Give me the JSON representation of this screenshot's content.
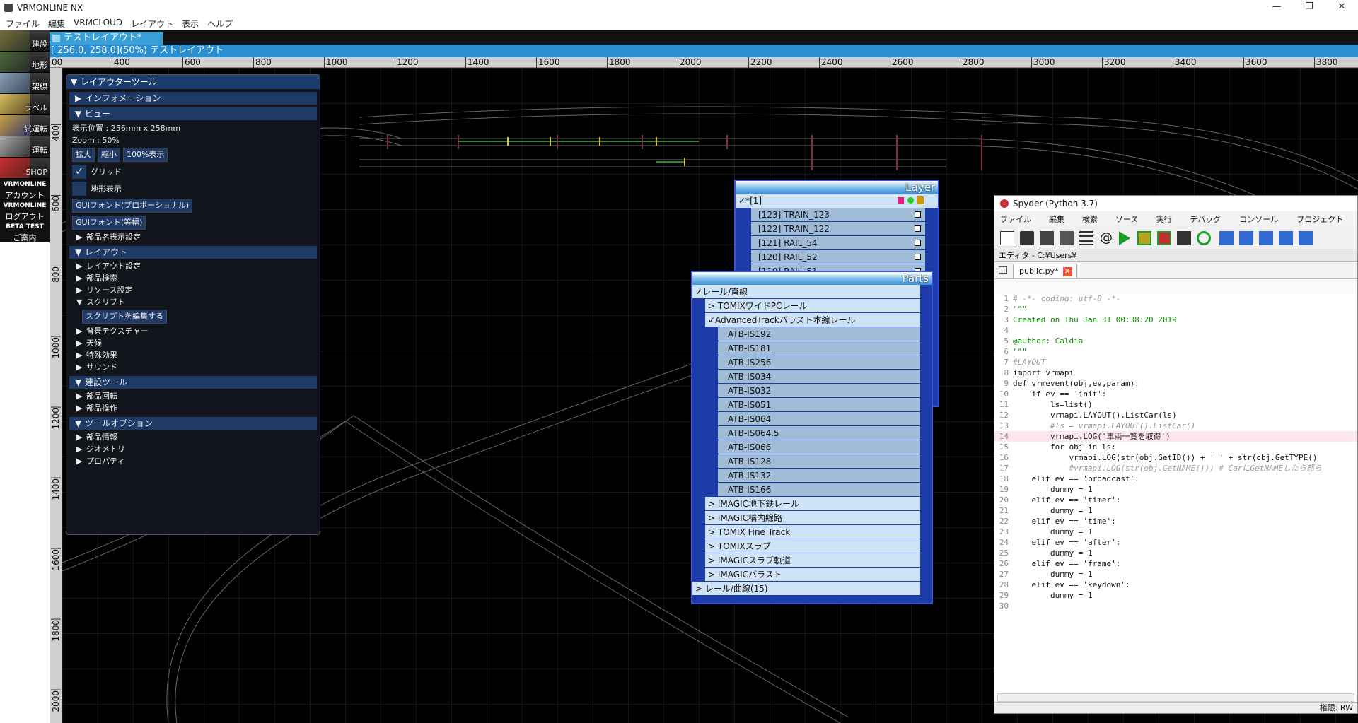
{
  "app": {
    "title": "VRMONLINE NX",
    "win_min": "—",
    "win_restore": "❐",
    "win_close": "✕"
  },
  "menu": [
    "ファイル",
    "編集",
    "VRMCLOUD",
    "レイアウト",
    "表示",
    "ヘルプ"
  ],
  "sidebar": [
    {
      "label": "建設"
    },
    {
      "label": "地形"
    },
    {
      "label": "架線"
    },
    {
      "label": "ラベル"
    },
    {
      "label": "試運転"
    },
    {
      "label": "運転"
    },
    {
      "label": "SHOP"
    }
  ],
  "sidebar_text_buttons": [
    {
      "line1": "VRMONLINE",
      "line2": "アカウント"
    },
    {
      "line1": "VRMONLINE",
      "line2": "ログアウト"
    },
    {
      "line1": "BETA TEST",
      "line2": "ご案内"
    }
  ],
  "document": {
    "tab": "テストレイアウト*",
    "path": "[ 256.0, 258.0](50%) テストレイアウト"
  },
  "ruler": {
    "h": [
      "00",
      "400",
      "600",
      "800",
      "1000",
      "1200",
      "1400",
      "1600",
      "1800",
      "2000",
      "2200",
      "2400",
      "2600",
      "2800",
      "3000",
      "3200",
      "3400",
      "3600",
      "3800"
    ],
    "v": [
      "400",
      "600",
      "800",
      "1000",
      "1200",
      "1400",
      "1600",
      "1800",
      "2000"
    ]
  },
  "panel": {
    "title": "レイアウターツール",
    "info": "インフォメーション",
    "view": "ビュー",
    "pos": "表示位置 : 256mm x 258mm",
    "zoom": "Zoom : 50%",
    "zoom_in": "拡大",
    "zoom_out": "縮小",
    "zoom_100": "100%表示",
    "grid": "グリッド",
    "terrain": "地形表示",
    "font_prop": "GUIフォント(プロポーショナル)",
    "font_mono": "GUIフォント(等幅)",
    "part_name": "部品名表示設定",
    "layout": "レイアウト",
    "layout_items": [
      "レイアウト設定",
      "部品検索",
      "リソース設定",
      "スクリプト"
    ],
    "edit_script": "スクリプトを編集する",
    "layout_items2": [
      "背景テクスチャー",
      "天候",
      "特殊効果",
      "サウンド"
    ],
    "build_tools": "建設ツール",
    "build_items": [
      "部品回転",
      "部品操作"
    ],
    "tool_options": "ツールオプション",
    "option_items": [
      "部品情報",
      "ジオメトリ",
      "プロパティ"
    ]
  },
  "layer": {
    "title": "Layer",
    "group": "*[1]",
    "rows": [
      "[123] TRAIN_123",
      "[122] TRAIN_122",
      "[121] RAIL_54",
      "[120] RAIL_52",
      "[119] RAIL_51"
    ]
  },
  "parts": {
    "title": "Parts",
    "group1": "レール/直線",
    "groups": [
      "TOMIXワイドPCレール",
      "AdvancedTrackバラスト本線レール"
    ],
    "leaves": [
      "ATB-IS192",
      "ATB-IS181",
      "ATB-IS256",
      "ATB-IS034",
      "ATB-IS032",
      "ATB-IS051",
      "ATB-IS064",
      "ATB-IS064.5",
      "ATB-IS066",
      "ATB-IS128",
      "ATB-IS132",
      "ATB-IS166"
    ],
    "groups2": [
      "IMAGIC地下鉄レール",
      "IMAGIC構内線路",
      "TOMIX Fine Track",
      "TOMIXスラブ",
      "IMAGICスラブ軌道",
      "IMAGICバラスト"
    ],
    "group_next": "レール/曲線(15)"
  },
  "spyder": {
    "title": "Spyder (Python 3.7)",
    "menu": [
      "ファイル(A)",
      "編集(E)",
      "検索(S)",
      "ソース(C)",
      "実行(R)",
      "デバッグ(D)",
      "コンソール(O)",
      "プロジェクト(P)"
    ],
    "editor_head": "エディタ - C:¥Users¥",
    "file_tab": "public.py*",
    "status": "権限: RW",
    "code": [
      {
        "t": "# -*- coding: utf-8 -*-",
        "c": "cm"
      },
      {
        "t": "\"\"\"",
        "c": "st"
      },
      {
        "t": "Created on Thu Jan 31 00:38:20 2019",
        "c": "st"
      },
      {
        "t": "",
        "c": "df"
      },
      {
        "t": "@author: Caldia",
        "c": "st"
      },
      {
        "t": "\"\"\"",
        "c": "st"
      },
      {
        "t": "#LAYOUT",
        "c": "cm"
      },
      {
        "t": "import vrmapi",
        "c": "df"
      },
      {
        "t": "def vrmevent(obj,ev,param):",
        "c": "df"
      },
      {
        "t": "    if ev == 'init':",
        "c": "df"
      },
      {
        "t": "        ls=list()",
        "c": "df"
      },
      {
        "t": "        vrmapi.LAYOUT().ListCar(ls)",
        "c": "df"
      },
      {
        "t": "        #ls = vrmapi.LAYOUT().ListCar()",
        "c": "cm"
      },
      {
        "t": "        vrmapi.LOG('車両一覧を取得')",
        "c": "df"
      },
      {
        "t": "        for obj in ls:",
        "c": "df"
      },
      {
        "t": "            vrmapi.LOG(str(obj.GetID()) + ' ' + str(obj.GetTYPE()",
        "c": "df"
      },
      {
        "t": "            #vrmapi.LOG(str(obj.GetNAME())) # CarにGetNAMEしたら怒ら",
        "c": "cm"
      },
      {
        "t": "    elif ev == 'broadcast':",
        "c": "df"
      },
      {
        "t": "        dummy = 1",
        "c": "df"
      },
      {
        "t": "    elif ev == 'timer':",
        "c": "df"
      },
      {
        "t": "        dummy = 1",
        "c": "df"
      },
      {
        "t": "    elif ev == 'time':",
        "c": "df"
      },
      {
        "t": "        dummy = 1",
        "c": "df"
      },
      {
        "t": "    elif ev == 'after':",
        "c": "df"
      },
      {
        "t": "        dummy = 1",
        "c": "df"
      },
      {
        "t": "    elif ev == 'frame':",
        "c": "df"
      },
      {
        "t": "        dummy = 1",
        "c": "df"
      },
      {
        "t": "    elif ev == 'keydown':",
        "c": "df"
      },
      {
        "t": "        dummy = 1",
        "c": "df"
      },
      {
        "t": "",
        "c": "df"
      }
    ],
    "current_line": 14
  }
}
